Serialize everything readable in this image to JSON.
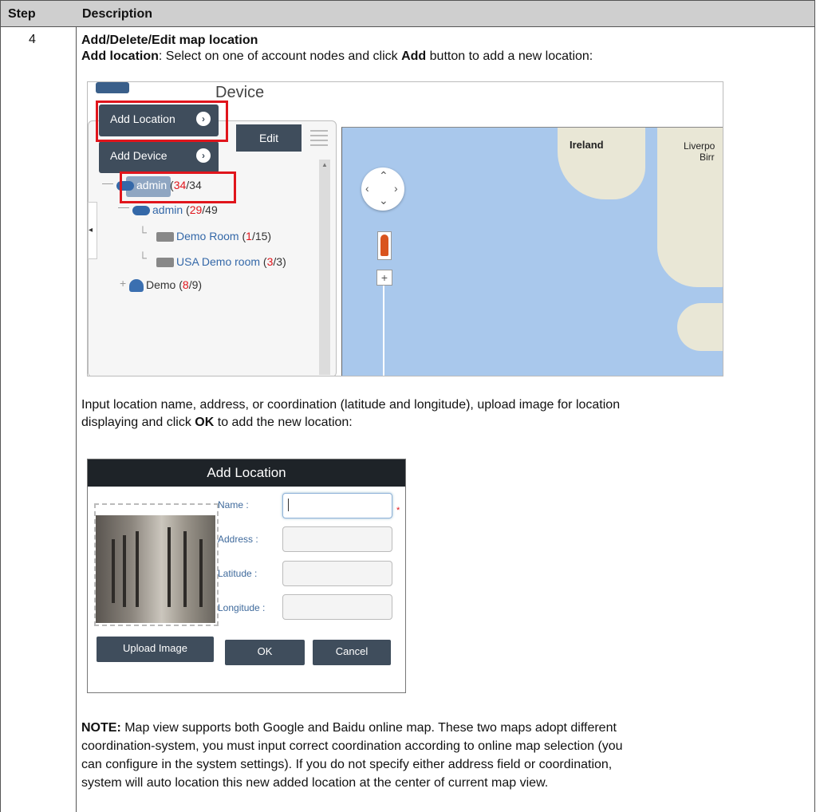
{
  "table": {
    "header_step": "Step",
    "header_description": "Description",
    "step_number": "4"
  },
  "content": {
    "heading": "Add/Delete/Edit map location",
    "add_location_bold": "Add location",
    "add_location_text": ": Select on one of account nodes and click ",
    "add_bold": "Add",
    "add_location_text_end": " button to add a new location:",
    "input_line1": "Input location name, address, or coordination (latitude and longitude), upload image for location",
    "input_line2_a": "displaying and click ",
    "input_line2_ok": "OK",
    "input_line2_b": " to add the new location:",
    "note_label": "NOTE:",
    "note_line1": " Map view supports both Google and Baidu online map. These two maps adopt different",
    "note_line2": "coordination-system, you must input correct coordination according to online map selection (you",
    "note_line3": "can configure in the system settings). If you do not specify either address field or coordination,",
    "note_line4": "system will auto location this new added location at the center of current map view."
  },
  "screenshot1": {
    "device_title": "Device",
    "add_location_btn": "Add Location",
    "add_device_btn": "Add Device",
    "edit_btn": "Edit",
    "tree": [
      {
        "label": "admin",
        "red": "34",
        "rest": "/34"
      },
      {
        "label": "admin",
        "red": "29",
        "rest": "/49"
      },
      {
        "label": "Demo Room",
        "pre": " (",
        "red": "1",
        "rest": "/15)"
      },
      {
        "label": "USA Demo room",
        "pre": " (",
        "red": "3",
        "rest": "/3)"
      },
      {
        "label": "Demo",
        "pre": " (",
        "red": "8",
        "rest": "/9)"
      }
    ],
    "map_labels": {
      "ireland": "Ireland",
      "liverpool": "Liverpo",
      "birm": "Birr"
    },
    "zoom_in": "+"
  },
  "screenshot2": {
    "title": "Add Location",
    "name_label": "Name :",
    "address_label": "Address :",
    "latitude_label": "Latitude :",
    "longitude_label": "Longitude :",
    "required_mark": "*",
    "upload_btn": "Upload Image",
    "ok_btn": "OK",
    "cancel_btn": "Cancel"
  },
  "colors": {
    "red_highlight": "#e0151c",
    "button_dark": "#3f4d5c",
    "dialog_title": "#1e2328",
    "map_sea": "#a9c8ec"
  }
}
